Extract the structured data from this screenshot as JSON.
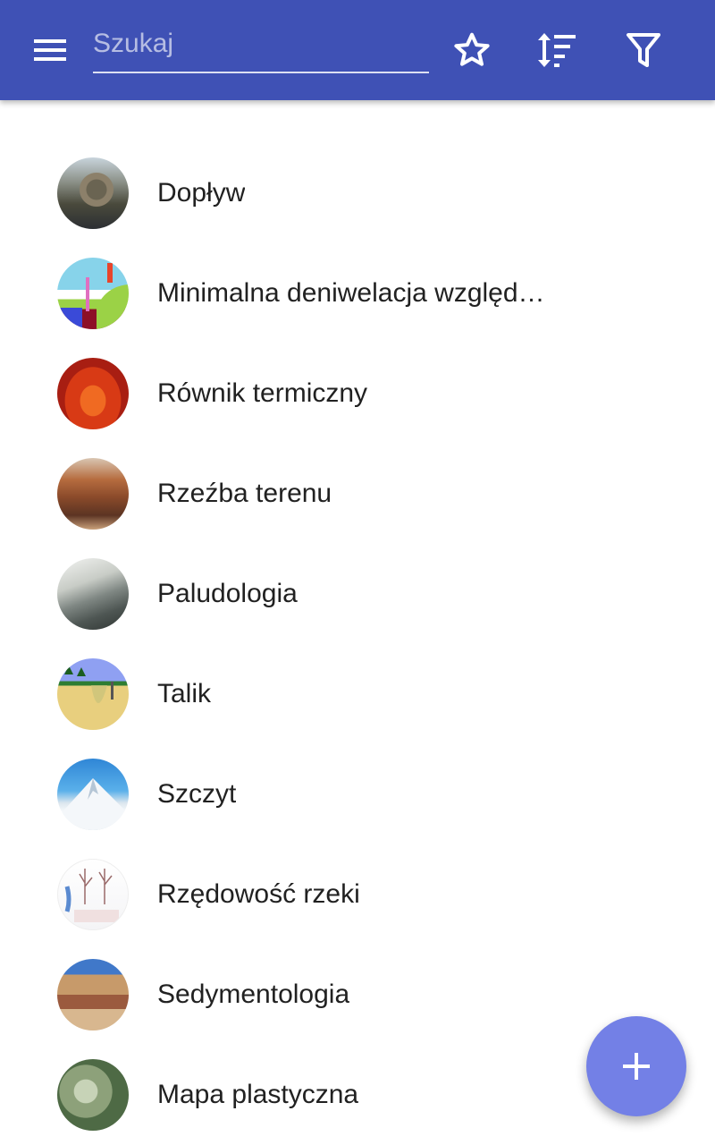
{
  "toolbar": {
    "menu_icon": "menu-icon",
    "search_placeholder": "Szukaj",
    "search_value": "",
    "favorite_icon": "star-outline-icon",
    "sort_icon": "sort-icon",
    "filter_icon": "filter-icon",
    "background_color": "#3f51b5"
  },
  "list": {
    "items": [
      {
        "label": "Dopływ",
        "thumbnail": "aerial river valley"
      },
      {
        "label": "Minimalna deniwelacja względ…",
        "thumbnail": "relative height diagram"
      },
      {
        "label": "Równik termiczny",
        "thumbnail": "temperature map"
      },
      {
        "label": "Rzeźba terenu",
        "thumbnail": "canyon landscape"
      },
      {
        "label": "Paludologia",
        "thumbnail": "misty wetland landscape"
      },
      {
        "label": "Talik",
        "thumbnail": "permafrost cross-section diagram"
      },
      {
        "label": "Szczyt",
        "thumbnail": "snowy mountain peak"
      },
      {
        "label": "Rzędowość rzeki",
        "thumbnail": "stream order diagram"
      },
      {
        "label": "Sedymentologia",
        "thumbnail": "layered rock strata"
      },
      {
        "label": "Mapa plastyczna",
        "thumbnail": "shaded relief map"
      }
    ]
  },
  "fab": {
    "icon": "plus-icon",
    "color": "#7380e6"
  }
}
